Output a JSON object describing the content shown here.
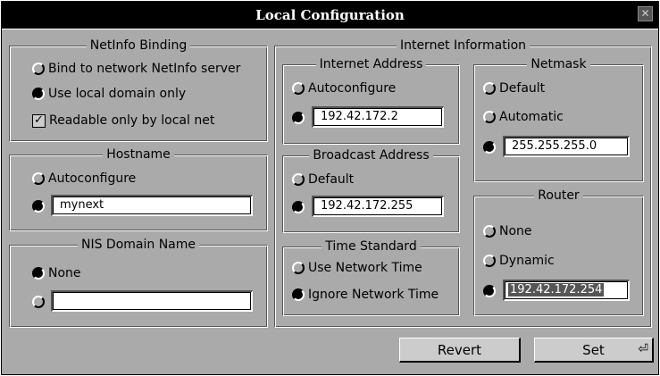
{
  "window": {
    "title": "Local Configuration",
    "close_glyph": "✕"
  },
  "netinfo": {
    "legend": "NetInfo Binding",
    "opt_bind": "Bind to network NetInfo server",
    "opt_local": "Use local domain only",
    "opt_readable": "Readable only by local net",
    "selected": "Use local domain only",
    "readable_checked": true
  },
  "hostname": {
    "legend": "Hostname",
    "opt_auto": "Autoconfigure",
    "value": "mynext",
    "selected": "manual"
  },
  "nis": {
    "legend": "NIS Domain Name",
    "opt_none": "None",
    "value": "",
    "selected": "None"
  },
  "internet": {
    "legend": "Internet Information",
    "address": {
      "legend": "Internet Address",
      "opt_auto": "Autoconfigure",
      "value": "192.42.172.2",
      "selected": "manual"
    },
    "broadcast": {
      "legend": "Broadcast Address",
      "opt_default": "Default",
      "value": "192.42.172.255",
      "selected": "manual"
    },
    "time": {
      "legend": "Time Standard",
      "opt_network": "Use Network Time",
      "opt_ignore": "Ignore Network Time",
      "selected": "Ignore Network Time"
    },
    "netmask": {
      "legend": "Netmask",
      "opt_default": "Default",
      "opt_auto": "Automatic",
      "value": "255.255.255.0",
      "selected": "manual"
    },
    "router": {
      "legend": "Router",
      "opt_none": "None",
      "opt_dynamic": "Dynamic",
      "value": "192.42.172.254",
      "selected": "manual"
    }
  },
  "buttons": {
    "revert": "Revert",
    "set": "Set",
    "enter_glyph": "⏎"
  }
}
